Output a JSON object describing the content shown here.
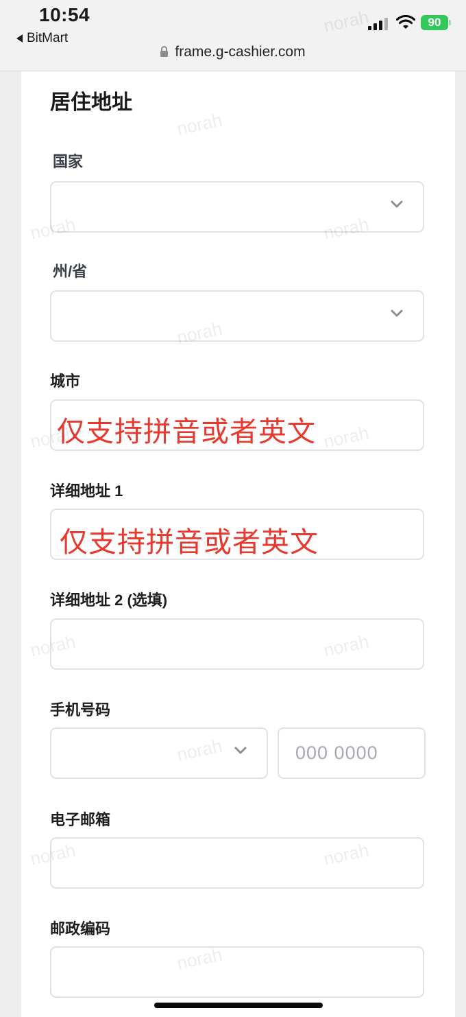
{
  "status_bar": {
    "time": "10:54",
    "back_label": "BitMart",
    "battery": "90"
  },
  "browser": {
    "url": "frame.g-cashier.com"
  },
  "form": {
    "title": "居住地址",
    "country": {
      "label": "国家",
      "value": ""
    },
    "state": {
      "label": "州/省",
      "value": ""
    },
    "city": {
      "label": "城市",
      "value": "仅支持拼音或者英文"
    },
    "address1": {
      "label": "详细地址 1",
      "value": "仅支持拼音或者英文"
    },
    "address2": {
      "label": "详细地址 2 (选填)",
      "value": ""
    },
    "phone": {
      "label": "手机号码",
      "code_value": "",
      "placeholder": "000 0000"
    },
    "email": {
      "label": "电子邮箱",
      "value": ""
    },
    "postcode": {
      "label": "邮政编码",
      "value": ""
    }
  },
  "watermark": "norah",
  "colors": {
    "hint": "#e8392f",
    "border": "#dfe2e6",
    "battery": "#34c759"
  }
}
